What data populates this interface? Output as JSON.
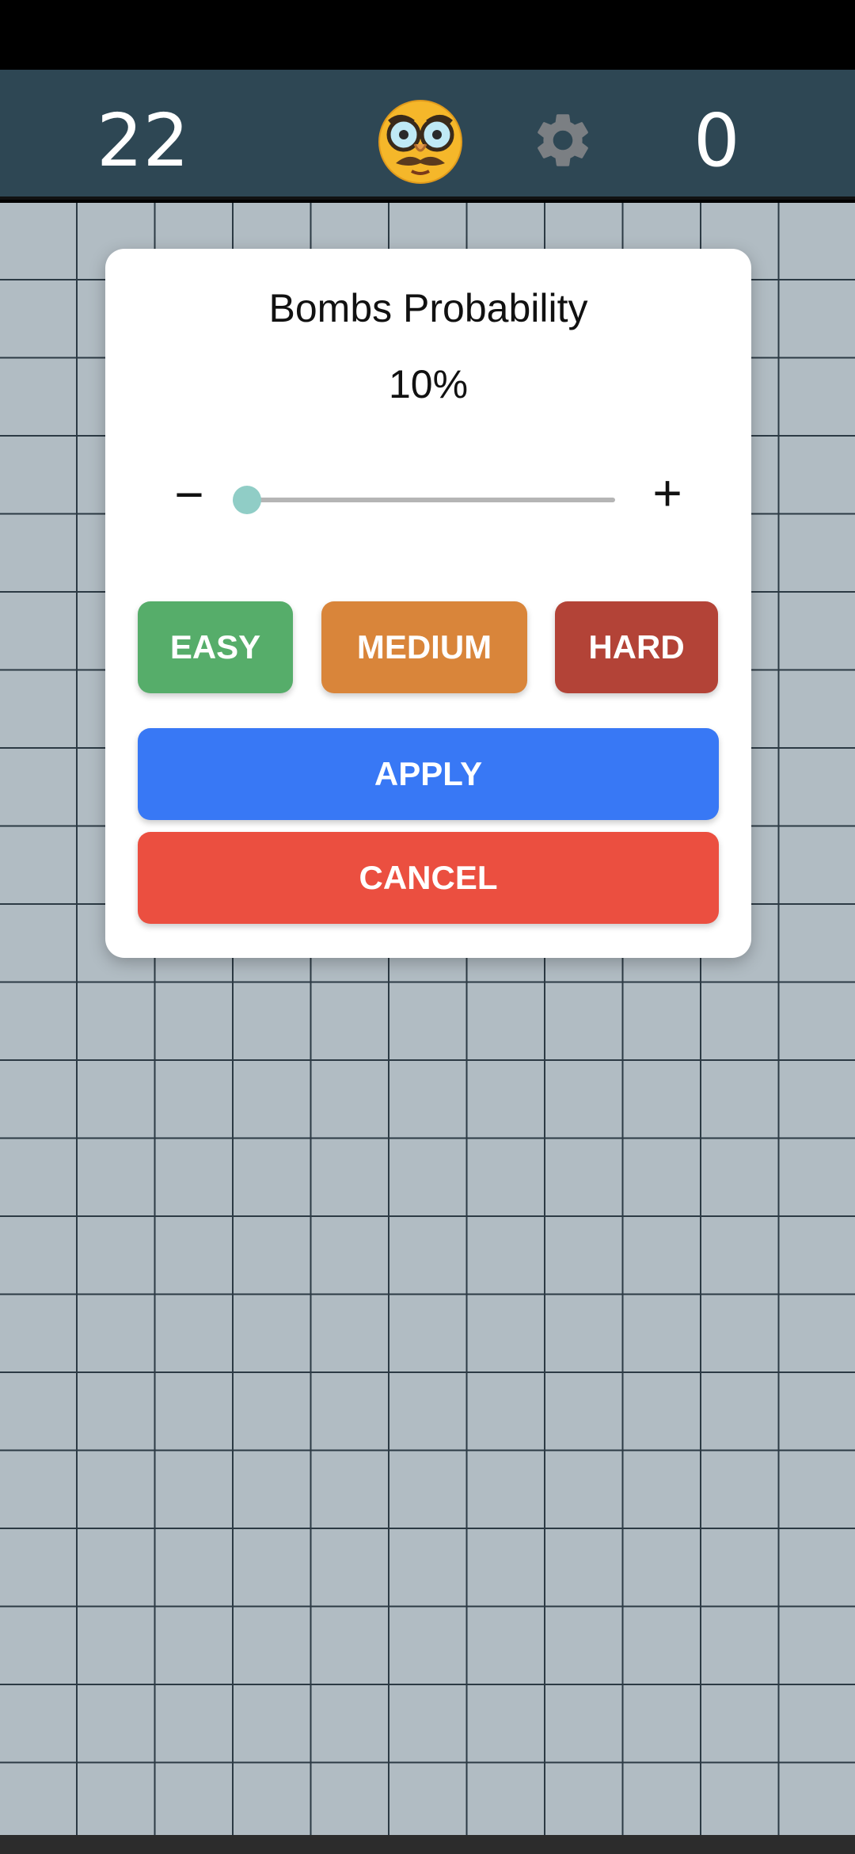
{
  "header": {
    "bombs_remaining": "22",
    "flags_count": "0",
    "face_icon": "disguised-face-icon",
    "settings_icon": "gear-icon"
  },
  "dialog": {
    "title": "Bombs Probability",
    "value_text": "10%",
    "slider_level": 0.02,
    "minus_label": "−",
    "plus_label": "+",
    "easy_label": "EASY",
    "medium_label": "MEDIUM",
    "hard_label": "HARD",
    "apply_label": "APPLY",
    "cancel_label": "CANCEL"
  },
  "colors": {
    "header_bg": "#2e4754",
    "board_bg": "#b1bcc3",
    "easy": "#56ad6a",
    "medium": "#d9853a",
    "hard": "#b34337",
    "apply": "#3878f5",
    "cancel": "#eb4f40",
    "slider_thumb": "#90cdc6"
  }
}
